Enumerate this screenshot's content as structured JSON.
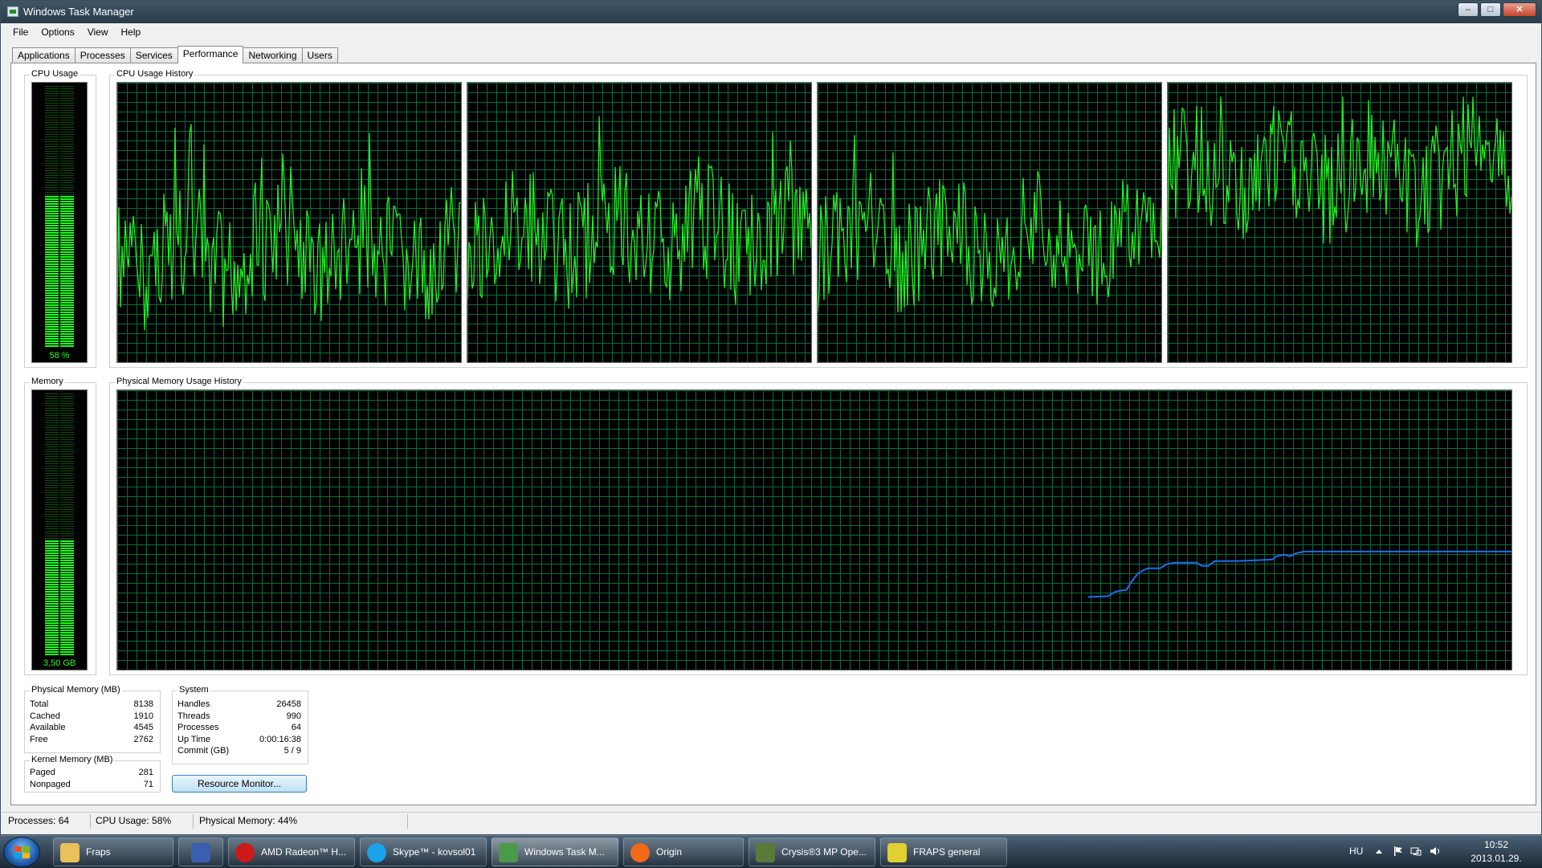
{
  "window": {
    "title": "Windows Task Manager"
  },
  "menu": [
    "File",
    "Options",
    "View",
    "Help"
  ],
  "tabs": [
    "Applications",
    "Processes",
    "Services",
    "Performance",
    "Networking",
    "Users"
  ],
  "active_tab": "Performance",
  "cpu_usage": {
    "label": "CPU Usage",
    "value_text": "58 %",
    "percent": 58
  },
  "cpu_history": {
    "label": "CPU Usage History",
    "core_count": 4
  },
  "memory": {
    "label": "Memory",
    "value_text": "3,50 GB",
    "fraction": 0.44
  },
  "memory_history": {
    "label": "Physical Memory Usage History",
    "line_color": "#1e6fe8"
  },
  "physical_memory": {
    "label": "Physical Memory (MB)",
    "rows": [
      {
        "key": "Total",
        "value": "8138"
      },
      {
        "key": "Cached",
        "value": "1910"
      },
      {
        "key": "Available",
        "value": "4545"
      },
      {
        "key": "Free",
        "value": "2762"
      }
    ]
  },
  "kernel_memory": {
    "label": "Kernel Memory (MB)",
    "rows": [
      {
        "key": "Paged",
        "value": "281"
      },
      {
        "key": "Nonpaged",
        "value": "71"
      }
    ]
  },
  "system": {
    "label": "System",
    "rows": [
      {
        "key": "Handles",
        "value": "26458"
      },
      {
        "key": "Threads",
        "value": "990"
      },
      {
        "key": "Processes",
        "value": "64"
      },
      {
        "key": "Up Time",
        "value": "0:00:16:38"
      },
      {
        "key": "Commit (GB)",
        "value": "5 / 9"
      }
    ]
  },
  "resource_monitor_button": "Resource Monitor...",
  "status": {
    "processes": "Processes: 64",
    "cpu": "CPU Usage: 58%",
    "memory": "Physical Memory: 44%"
  },
  "taskbar": {
    "items": [
      {
        "label": "Fraps",
        "icon": "folder-icon",
        "color": "#e8c15a"
      },
      {
        "label": "",
        "icon": "floppy-disk-icon",
        "color": "#3a5fb0"
      },
      {
        "label": "AMD Radeon™ H...",
        "icon": "opera-icon",
        "color": "#cc1a1a"
      },
      {
        "label": "Skype™ - kovsol01",
        "icon": "skype-icon",
        "color": "#1aa3e8"
      },
      {
        "label": "Windows Task M...",
        "icon": "task-manager-icon",
        "color": "#4a9a4a",
        "active": true
      },
      {
        "label": "Origin",
        "icon": "origin-icon",
        "color": "#f06a1a"
      },
      {
        "label": "Crysis®3 MP Ope...",
        "icon": "crysis-icon",
        "color": "#5a7a3a"
      },
      {
        "label": "FRAPS general",
        "icon": "fraps-icon",
        "color": "#e0d030"
      }
    ],
    "language": "HU",
    "time": "10:52",
    "date": "2013.01.29."
  },
  "graph_colors": {
    "cpu_line": "#22ee22",
    "grid": "#0b6b3a"
  }
}
